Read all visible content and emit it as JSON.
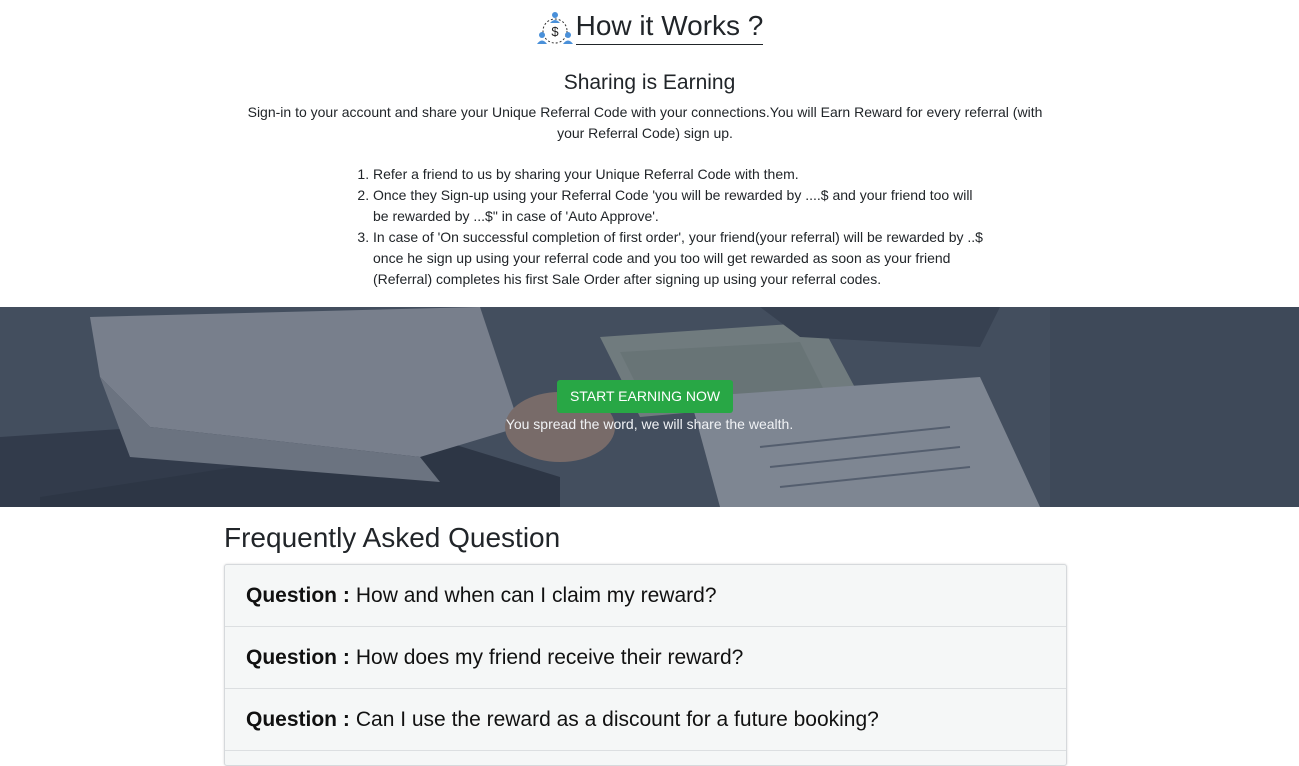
{
  "header": {
    "title": "How it Works ?",
    "icon": "referral-money-icon"
  },
  "section": {
    "subtitle": "Sharing is Earning",
    "intro": "Sign-in to your account and share your Unique Referral Code with your connections.You will Earn Reward for every referral (with your Referral Code) sign up."
  },
  "steps": [
    "Refer a friend to us by sharing your Unique Referral Code with them.",
    "Once they Sign-up using your Referral Code 'you will be rewarded by ....$ and your friend too will be rewarded by ...$\" in case of 'Auto Approve'.",
    "In case of 'On successful completion of first order', your friend(your referral) will be rewarded by ..$ once he sign up using your referral code and you too will get rewarded as soon as your friend (Referral) completes his first Sale Order after signing up using your referral codes."
  ],
  "hero": {
    "button_label": "START EARNING NOW",
    "tagline": "You spread the word, we will share the wealth.",
    "button_color": "#28a745"
  },
  "faq": {
    "title": "Frequently Asked Question",
    "question_prefix": "Question :",
    "items": [
      {
        "question": "How and when can I claim my reward?"
      },
      {
        "question": "How does my friend receive their reward?"
      },
      {
        "question": "Can I use the reward as a discount for a future booking?"
      }
    ]
  }
}
